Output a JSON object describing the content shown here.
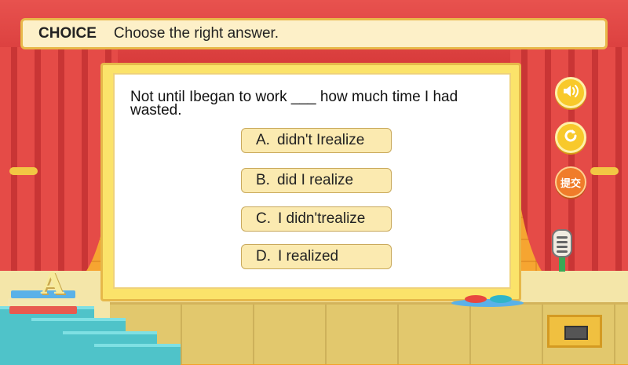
{
  "header": {
    "label": "CHOICE",
    "instruction": "Choose the right answer."
  },
  "question": {
    "text": "Not until Ibegan to work ___ how much time I had wasted."
  },
  "options": [
    {
      "letter": "A.",
      "text": "didn't Irealize"
    },
    {
      "letter": "B.",
      "text": "did I realize"
    },
    {
      "letter": "C.",
      "text": "I didn'trealize"
    },
    {
      "letter": "D.",
      "text": "I realized"
    }
  ],
  "controls": {
    "sound_icon": "speaker-icon",
    "replay_icon": "refresh-icon",
    "submit_label": "提交"
  },
  "decor": {
    "stage_letter": "A"
  },
  "colors": {
    "curtain": "#e54b47",
    "wall": "#f6a531",
    "board_frame": "#fbe36a",
    "option_bg": "#fbeab0",
    "header_bg": "#fdf0c8"
  }
}
